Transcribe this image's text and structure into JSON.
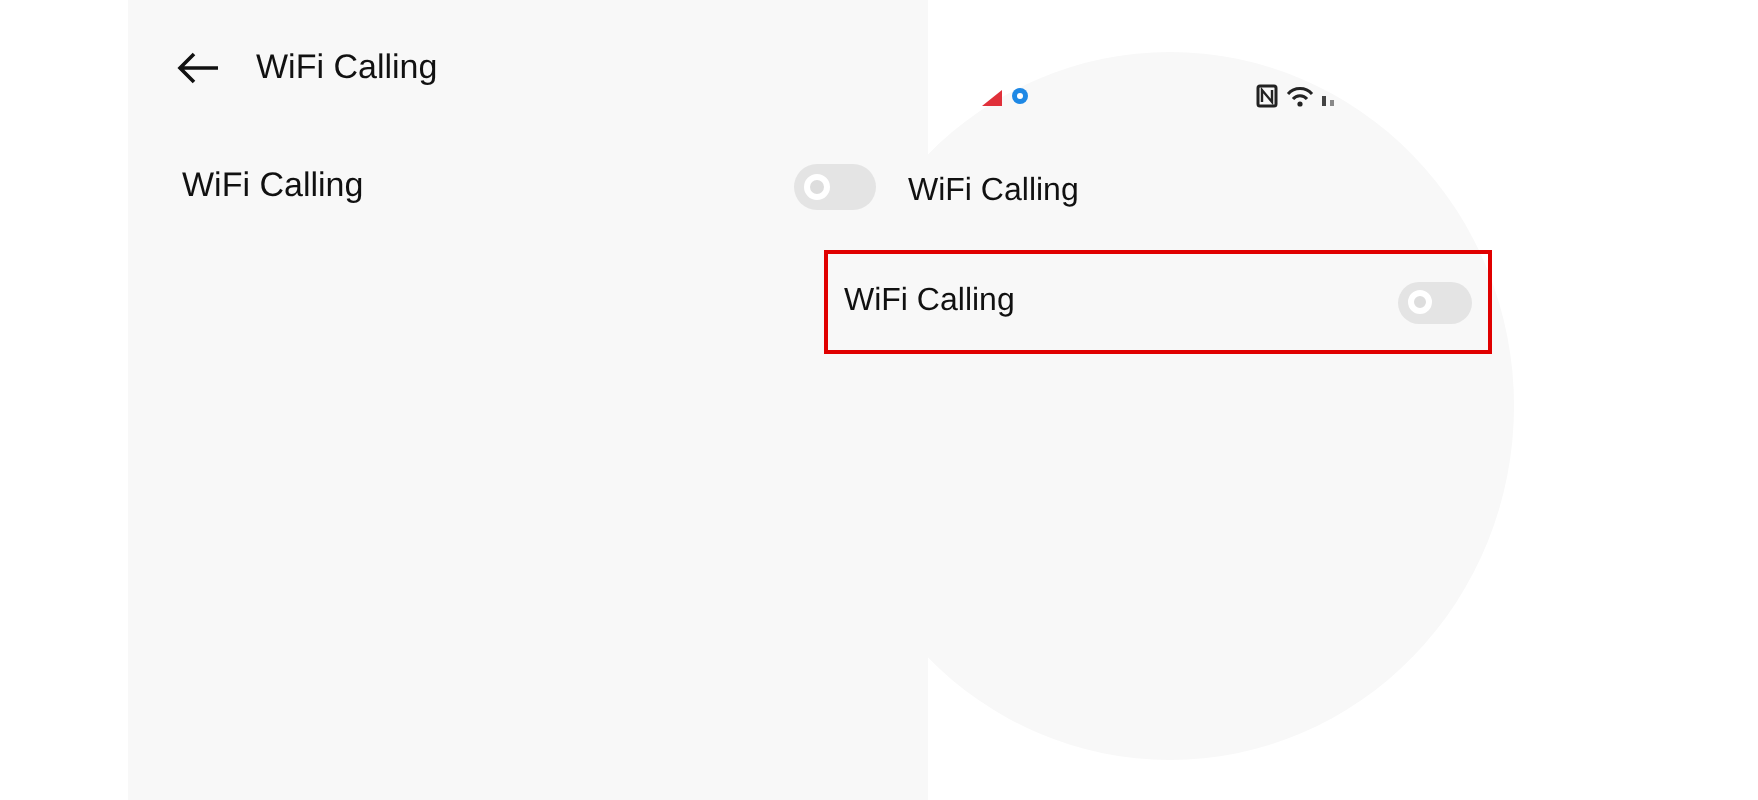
{
  "panel": {
    "header": {
      "title": "WiFi Calling"
    },
    "settings": [
      {
        "label": "WiFi Calling",
        "on": false
      }
    ]
  },
  "magnifier": {
    "title": "WiFi Calling",
    "settings": [
      {
        "label": "WiFi Calling",
        "on": false,
        "highlighted": true
      }
    ]
  }
}
